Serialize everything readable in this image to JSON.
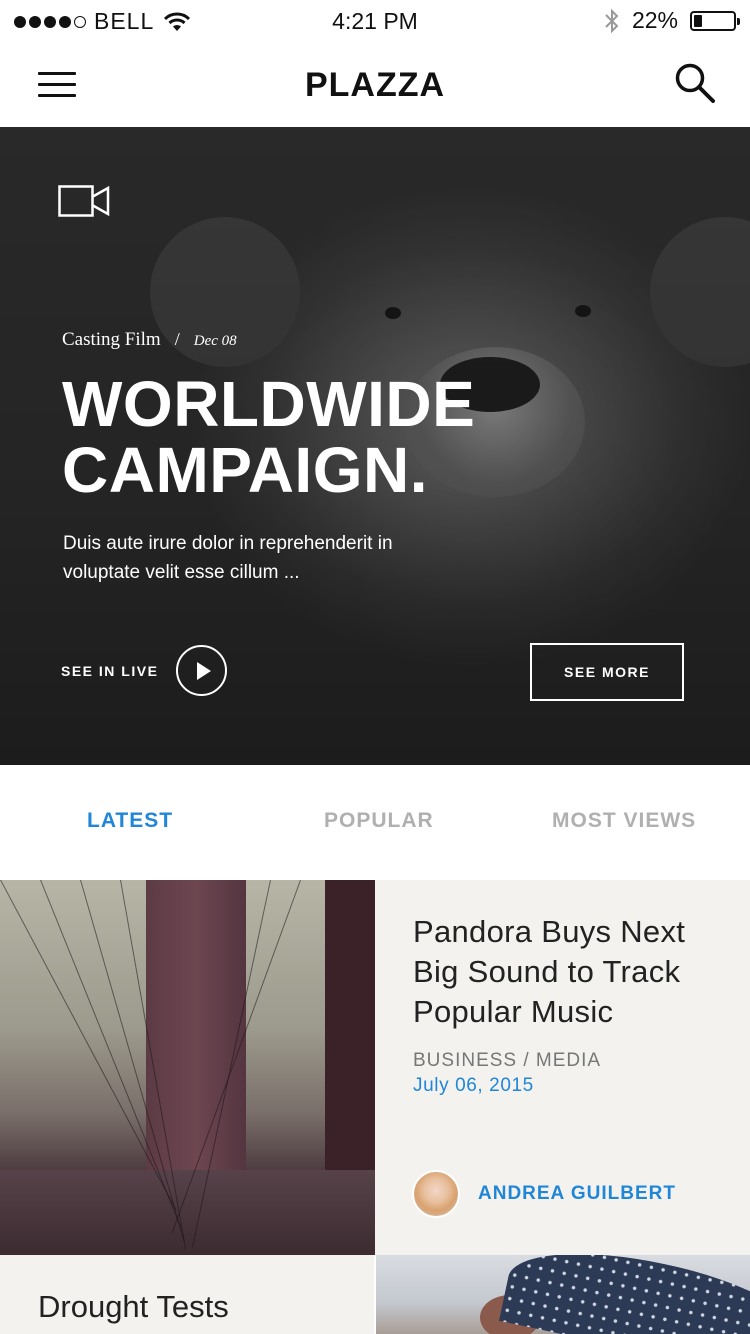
{
  "status_bar": {
    "carrier": "BELL",
    "time": "4:21 PM",
    "battery_percent": "22%",
    "battery_level": 0.22,
    "signal_dots_filled": 4,
    "icons": [
      "signal-dots",
      "wifi-icon",
      "bluetooth-icon",
      "battery-icon"
    ]
  },
  "nav": {
    "logo": "PLAZZA",
    "menu_icon": "hamburger-menu-icon",
    "search_icon": "search-icon"
  },
  "hero": {
    "video_icon": "video-camera-icon",
    "category": "Casting Film",
    "separator": "/",
    "date": "Dec 08",
    "title_line1": "WORLDWIDE",
    "title_line2": "CAMPAIGN.",
    "description": "Duis aute irure dolor in reprehenderit in voluptate velit esse cillum ...",
    "live_label": "SEE IN LIVE",
    "play_icon": "play-icon",
    "more_label": "SEE MORE"
  },
  "tabs": [
    {
      "label": "LATEST",
      "active": true
    },
    {
      "label": "POPULAR",
      "active": false
    },
    {
      "label": "MOST VIEWS",
      "active": false
    }
  ],
  "articles": [
    {
      "title": "Pandora Buys Next Big Sound to Track Popular Music",
      "category": "BUSINESS / MEDIA",
      "date": "July 06, 2015",
      "author": "ANDREA GUILBERT"
    },
    {
      "title": "Drought Tests"
    }
  ],
  "colors": {
    "accent": "#1f86d8",
    "tab_inactive": "#b0b0b0",
    "card_bg": "#f3f2ee"
  }
}
